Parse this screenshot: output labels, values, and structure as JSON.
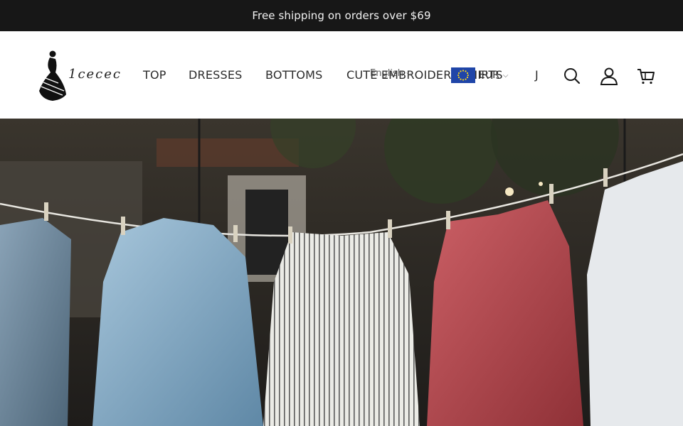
{
  "announcement": {
    "text": "Free shipping on orders over $69"
  },
  "logo": {
    "text": "1cecec"
  },
  "nav": {
    "items": [
      {
        "label": "TOP"
      },
      {
        "label": "DRESSES"
      },
      {
        "label": "BOTTOMS"
      },
      {
        "label": "CUTE EMBROIDERY SHIRTS"
      },
      {
        "label": "J"
      }
    ]
  },
  "language": {
    "label": "English"
  },
  "currency": {
    "code": "EUR"
  },
  "icons": [
    "search-icon",
    "account-icon",
    "cart-icon"
  ],
  "colors": {
    "announcement_bg": "#171717",
    "flag_blue": "#1f45a8",
    "flag_stars": "#f7d21e",
    "shirt_red": "#b3484d"
  }
}
